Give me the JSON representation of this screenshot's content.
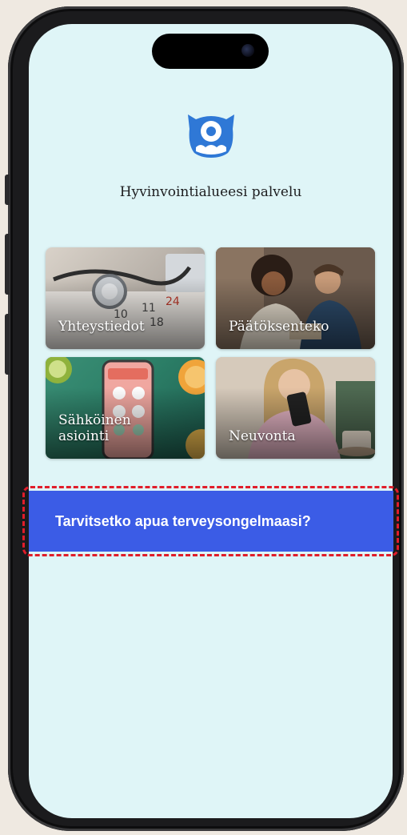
{
  "app": {
    "service_title": "Hyvinvointialueesi palvelu",
    "logo_icon": "monster-logo-icon",
    "accent_color": "#2f78d6"
  },
  "tiles": [
    {
      "label": "Yhteystiedot",
      "image": "stethoscope-calendar-photo"
    },
    {
      "label": "Päätöksenteko",
      "image": "two-people-meeting-photo"
    },
    {
      "label": "Sähköinen\nasiointi",
      "image": "mobile-app-fruit-photo"
    },
    {
      "label": "Neuvonta",
      "image": "woman-with-phone-photo"
    }
  ],
  "help_button": {
    "label": "Tarvitsetko apua terveysongelmaasi?",
    "color": "#3b5ce6",
    "highlight_color": "#e11d2a"
  }
}
